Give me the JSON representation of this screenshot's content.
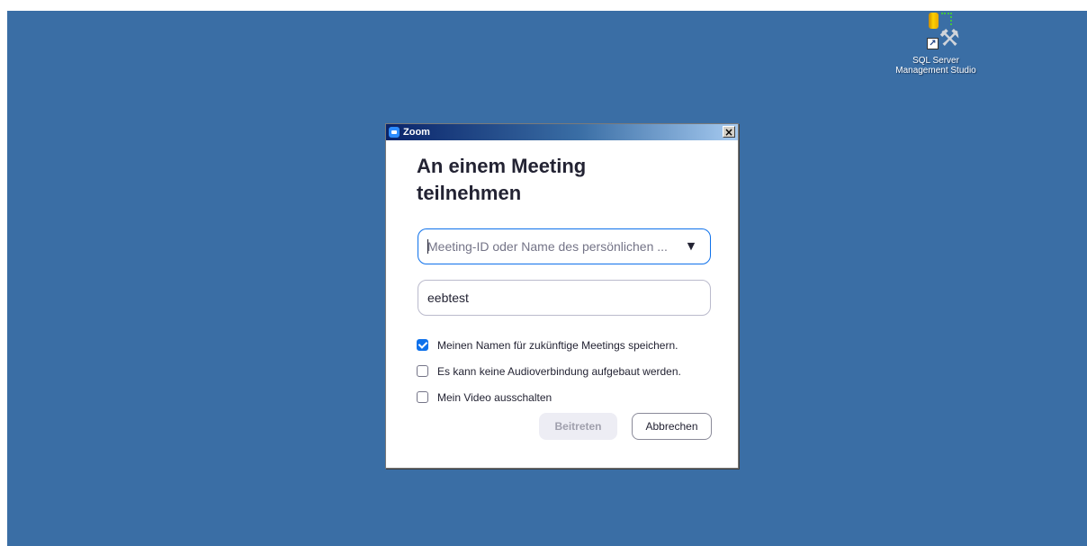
{
  "desktop": {
    "background": "#3a6ea5",
    "icon": {
      "name": "sql-server-management-studio-icon",
      "label_line1": "SQL Server",
      "label_line2": "Management Studio"
    }
  },
  "dialog": {
    "title": "Zoom",
    "heading_line1": "An einem Meeting",
    "heading_line2": "teilnehmen",
    "meeting_id": {
      "value": "",
      "placeholder": "Meeting-ID oder Name des persönlichen ..."
    },
    "name_field": {
      "value": "eebtest"
    },
    "checkboxes": [
      {
        "label": "Meinen Namen für zukünftige Meetings speichern.",
        "checked": true
      },
      {
        "label": "Es kann keine Audioverbindung aufgebaut werden.",
        "checked": false
      },
      {
        "label": "Mein Video ausschalten",
        "checked": false
      }
    ],
    "join_label": "Beitreten",
    "cancel_label": "Abbrechen",
    "colors": {
      "accent": "#0e71eb",
      "text": "#232333"
    }
  }
}
